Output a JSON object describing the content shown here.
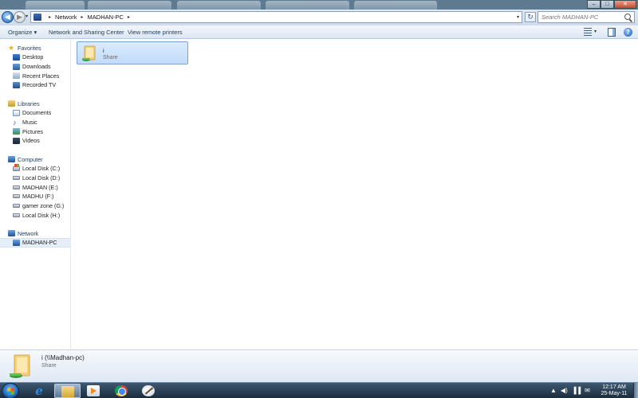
{
  "window": {
    "minimize_label": "–",
    "maximize_label": "□",
    "close_label": "✕"
  },
  "address": {
    "crumbs": [
      "Network",
      "MADHAN-PC"
    ],
    "separator": "▸",
    "dropdown": "▾",
    "refresh_label": "↻"
  },
  "search": {
    "placeholder": "Search MADHAN-PC"
  },
  "toolbar": {
    "organize_label": "Organize ▾",
    "network_sharing_label": "Network and Sharing Center",
    "view_printers_label": "View remote printers",
    "view_dropdown": "▾",
    "help_label": "?"
  },
  "nav": {
    "favorites": {
      "label": "Favorites",
      "items": [
        "Desktop",
        "Downloads",
        "Recent Places",
        "Recorded TV"
      ]
    },
    "libraries": {
      "label": "Libraries",
      "items": [
        "Documents",
        "Music",
        "Pictures",
        "Videos"
      ]
    },
    "computer": {
      "label": "Computer",
      "items": [
        "Local Disk (C:)",
        "Local Disk (D:)",
        "MADHAN (E:)",
        "MADHU (F:)",
        "gamer zone (G:)",
        "Local Disk (H:)"
      ]
    },
    "network": {
      "label": "Network",
      "items": [
        "MADHAN-PC"
      ]
    }
  },
  "content": {
    "items": [
      {
        "name": "i",
        "type": "Share"
      }
    ]
  },
  "details": {
    "name": "i (\\\\Madhan-pc)",
    "type": "Share"
  },
  "taskbar": {
    "clock_time": "12:17 AM",
    "clock_date": "25-May-11",
    "tray_icons": [
      "▲",
      "◀)",
      "▐▐",
      "✉"
    ]
  },
  "colors": {
    "selection": "#c1dcfc",
    "accent": "#1e3957"
  }
}
